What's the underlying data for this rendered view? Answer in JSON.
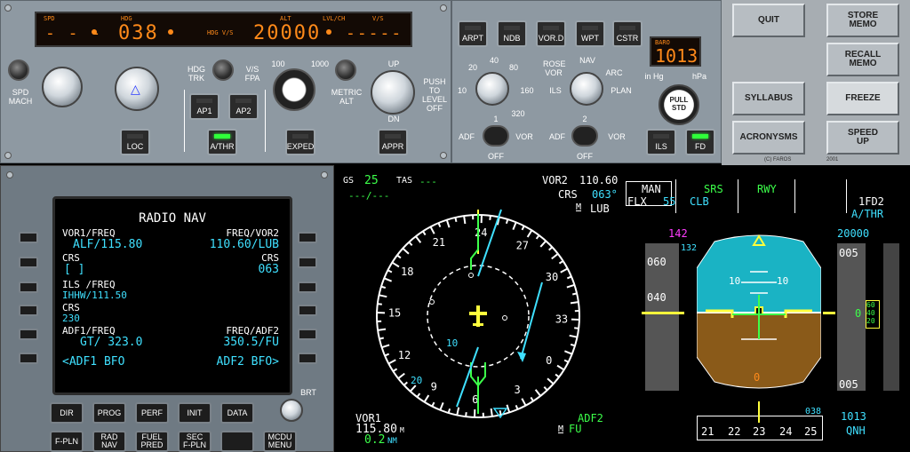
{
  "fcu": {
    "spd_label": "SPD",
    "hdg_label": "HDG",
    "hdg_vs_label": "HDG V/S",
    "alt_label": "ALT",
    "lvl_ch_label": "LVL/CH",
    "vs_label": "V/S",
    "spd_value": "- - -",
    "hdg_value": "038",
    "alt_value": "20000",
    "vs_value": "-----",
    "spd_mach_label": "SPD\nMACH",
    "hdg_trk_label": "HDG\nTRK",
    "vs_fpa_label": "V/S\nFPA",
    "alt_100": "100",
    "alt_1000": "1000",
    "metric_alt_label": "METRIC\nALT",
    "up_label": "UP",
    "dn_label": "DN",
    "push_level_off": "PUSH\nTO\nLEVEL\nOFF",
    "buttons": {
      "loc": "LOC",
      "ap1": "AP1",
      "ap2": "AP2",
      "athr": "A/THR",
      "exped": "EXPED",
      "appr": "APPR"
    }
  },
  "efis": {
    "buttons": {
      "arpt": "ARPT",
      "ndb": "NDB",
      "vord": "VOR.D",
      "wpt": "WPT",
      "cstr": "CSTR",
      "ils": "ILS",
      "fd": "FD"
    },
    "range_labels": {
      "r10": "10",
      "r20": "20",
      "r40": "40",
      "r80": "80",
      "r160": "160",
      "r320": "320"
    },
    "mode_labels": {
      "rose": "ROSE",
      "vor": "VOR",
      "nav": "NAV",
      "arc": "ARC",
      "ils": "ILS",
      "plan": "PLAN"
    },
    "baro_label": "BARO",
    "baro_value": "1013",
    "in_hg": "in Hg",
    "hpa": "hPa",
    "pull_std": "PULL\nSTD",
    "adf1": "ADF",
    "vor1": "VOR",
    "off1": "OFF",
    "n1": "1",
    "adf2": "ADF",
    "vor2": "VOR",
    "off2": "OFF",
    "n2": "2"
  },
  "menu": {
    "quit": "QUIT",
    "store_memo": "STORE\nMEMO",
    "recall_memo": "RECALL\nMEMO",
    "syllabus": "SYLLABUS",
    "freeze": "FREEZE",
    "acronysms": "ACRONYSMS",
    "speed_up": "SPEED\nUP",
    "copyright": "(C) FAROS",
    "year": "2001"
  },
  "mcdu": {
    "title": "RADIO NAV",
    "l1_label": "VOR1/FREQ",
    "r1_label": "FREQ/VOR2",
    "l1_value": "ALF/115.80",
    "r1_value": "110.60/LUB",
    "l2_label": "CRS",
    "r2_label": "CRS",
    "l2_value": "[ ]",
    "r2_value": "063",
    "l3_label": "ILS /FREQ",
    "l3_value": "IHHW/111.50",
    "l4_label": "CRS",
    "l4_value": "230",
    "l5_label": "ADF1/FREQ",
    "r5_label": "FREQ/ADF2",
    "l5_value": "GT/ 323.0",
    "r5_value": "350.5/FU",
    "l6_value": "<ADF1 BFO",
    "r6_value": "ADF2 BFO>",
    "brt": "BRT",
    "keys": [
      "DIR",
      "PROG",
      "PERF",
      "INIT",
      "DATA",
      "F-PLN",
      "RAD\nNAV",
      "FUEL\nPRED",
      "SEC\nF-PLN",
      "",
      "MCDU\nMENU"
    ]
  },
  "nd": {
    "gs_label": "GS",
    "gs_value": "25",
    "tas_label": "TAS",
    "tas_value": "---",
    "wind": "---/---",
    "vor2_label": "VOR2",
    "vor2_freq": "110.60",
    "crs_label": "CRS",
    "crs_value": "063°",
    "vor2_ident": "LUB",
    "vor2_m": "M",
    "vor1_label": "VOR1",
    "vor1_dist": "115.80",
    "vor1_unit": "M",
    "vor1_dme": "0.2",
    "vor1_nm": "NM",
    "adf2_label": "ADF2",
    "adf2_m": "M",
    "adf2_ident": "FU",
    "range_inner": "10",
    "range_outer": "20",
    "heading_labels": [
      "24",
      "27",
      "30",
      "33",
      "21",
      "18",
      "15",
      "12",
      "9",
      "6",
      "3",
      "0"
    ]
  },
  "pfd": {
    "fma_man": "MAN",
    "fma_flx": "FLX",
    "fma_flx_temp": "55",
    "fma_clb": "CLB",
    "fma_srs": "SRS",
    "fma_rwy": "RWY",
    "fma_1fd2": "1FD2",
    "fma_athr": "A/THR",
    "speed_target": "142",
    "speed_132": "132",
    "speed_060": "060",
    "speed_040": "040",
    "alt_target": "20000",
    "alt_005a": "005",
    "alt_005b": "005",
    "alt_0": "0",
    "alt_40": "40",
    "alt_20": "20",
    "alt_60": "60",
    "pitch_10l": "10",
    "pitch_10r": "10",
    "hdg_crs": "038",
    "hdg_ticks": [
      "21",
      "22",
      "23",
      "24",
      "25"
    ],
    "baro": "1013",
    "qnh": "QNH",
    "zero": "0"
  }
}
